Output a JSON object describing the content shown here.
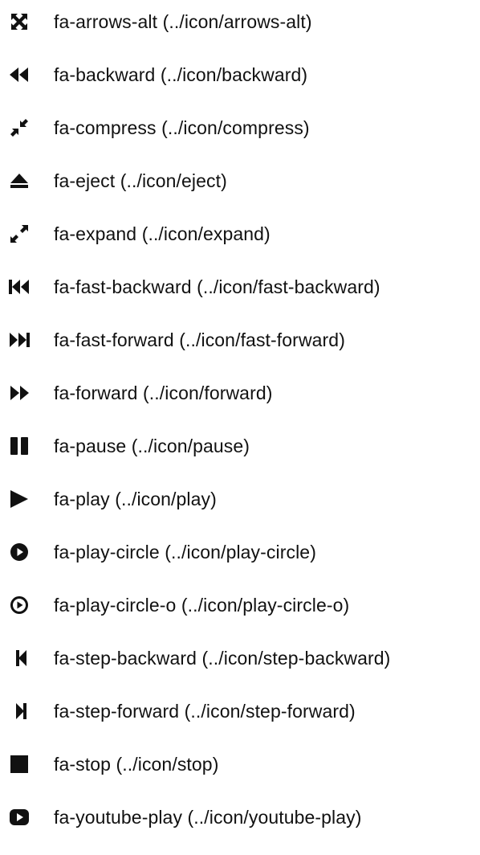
{
  "icons": [
    {
      "name": "arrows-alt-icon",
      "label": "fa-arrows-alt (../icon/arrows-alt)"
    },
    {
      "name": "backward-icon",
      "label": "fa-backward (../icon/backward)"
    },
    {
      "name": "compress-icon",
      "label": "fa-compress (../icon/compress)"
    },
    {
      "name": "eject-icon",
      "label": "fa-eject (../icon/eject)"
    },
    {
      "name": "expand-icon",
      "label": "fa-expand (../icon/expand)"
    },
    {
      "name": "fast-backward-icon",
      "label": "fa-fast-backward (../icon/fast-backward)"
    },
    {
      "name": "fast-forward-icon",
      "label": "fa-fast-forward (../icon/fast-forward)"
    },
    {
      "name": "forward-icon",
      "label": "fa-forward (../icon/forward)"
    },
    {
      "name": "pause-icon",
      "label": "fa-pause (../icon/pause)"
    },
    {
      "name": "play-icon",
      "label": "fa-play (../icon/play)"
    },
    {
      "name": "play-circle-icon",
      "label": "fa-play-circle (../icon/play-circle)"
    },
    {
      "name": "play-circle-o-icon",
      "label": "fa-play-circle-o (../icon/play-circle-o)"
    },
    {
      "name": "step-backward-icon",
      "label": "fa-step-backward (../icon/step-backward)"
    },
    {
      "name": "step-forward-icon",
      "label": "fa-step-forward (../icon/step-forward)"
    },
    {
      "name": "stop-icon",
      "label": "fa-stop (../icon/stop)"
    },
    {
      "name": "youtube-play-icon",
      "label": "fa-youtube-play (../icon/youtube-play)"
    }
  ]
}
